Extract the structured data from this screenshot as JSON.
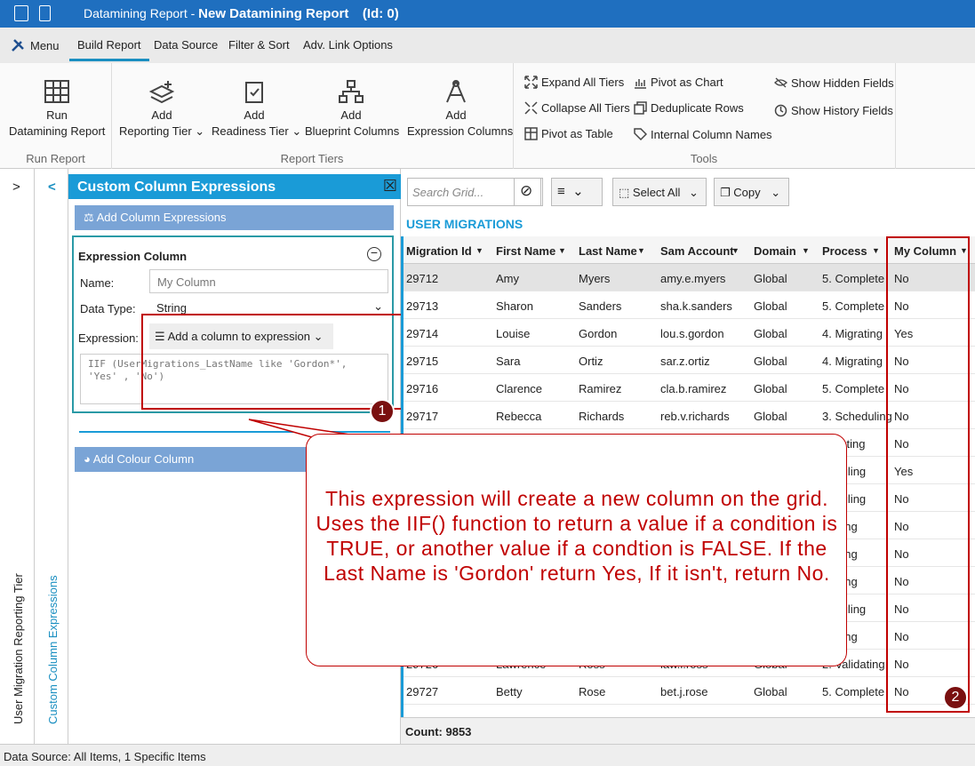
{
  "titlebar": {
    "app": "Datamining Report - ",
    "report": "New Datamining Report",
    "id": "(Id: 0)"
  },
  "menubar": {
    "menu": "Menu",
    "tabs": [
      "Build Report",
      "Data Source",
      "Filter & Sort",
      "Adv. Link Options"
    ]
  },
  "ribbon": {
    "run": {
      "line1": "Run",
      "line2": "Datamining Report"
    },
    "add_reporting": {
      "line1": "Add",
      "line2": "Reporting Tier"
    },
    "add_readiness": {
      "line1": "Add",
      "line2": "Readiness Tier"
    },
    "add_blueprint": {
      "line1": "Add",
      "line2": "Blueprint Columns"
    },
    "add_expression": {
      "line1": "Add",
      "line2": "Expression Columns"
    },
    "groups": {
      "run": "Run Report",
      "tiers": "Report Tiers",
      "tools": "Tools"
    },
    "tools": {
      "expand": "Expand All Tiers",
      "collapse": "Collapse All Tiers",
      "pivot_table": "Pivot as Table",
      "pivot_chart": "Pivot as Chart",
      "dedup": "Deduplicate Rows",
      "internal": "Internal Column Names",
      "hidden": "Show Hidden Fields",
      "history": "Show History Fields"
    }
  },
  "sidebar": {
    "tier_label": "User Migration Reporting Tier",
    "expr_label": "Custom Column Expressions",
    "expand": ">",
    "collapse": "<"
  },
  "panel": {
    "title": "Custom Column Expressions",
    "close": "☒",
    "add_expr": "Add Column Expressions",
    "section_title": "Expression Column",
    "name_label": "Name:",
    "name_placeholder": "My Column",
    "type_label": "Data Type:",
    "type_value": "String",
    "expr_label": "Expression:",
    "add_col_btn": "Add a column to expression",
    "expr_text": "IIF (UserMigrations_LastName like 'Gordon*', 'Yes' , 'No')",
    "add_colour": "Add Colour Column"
  },
  "grid": {
    "search_placeholder": "Search Grid...",
    "select_all": "Select All",
    "copy": "Copy",
    "title": "USER MIGRATIONS",
    "columns": [
      "Migration Id",
      "First Name",
      "Last Name",
      "Sam Account",
      "Domain",
      "Process",
      "My Column"
    ],
    "rows": [
      [
        "29712",
        "Amy",
        "Myers",
        "amy.e.myers",
        "Global",
        "5. Complete",
        "No"
      ],
      [
        "29713",
        "Sharon",
        "Sanders",
        "sha.k.sanders",
        "Global",
        "5. Complete",
        "No"
      ],
      [
        "29714",
        "Louise",
        "Gordon",
        "lou.s.gordon",
        "Global",
        "4. Migrating",
        "Yes"
      ],
      [
        "29715",
        "Sara",
        "Ortiz",
        "sar.z.ortiz",
        "Global",
        "4. Migrating",
        "No"
      ],
      [
        "29716",
        "Clarence",
        "Ramirez",
        "cla.b.ramirez",
        "Global",
        "5. Complete",
        "No"
      ],
      [
        "29717",
        "Rebecca",
        "Richards",
        "reb.v.richards",
        "Global",
        "3. Scheduling",
        "No"
      ],
      [
        "",
        "",
        "",
        "",
        "",
        "alidating",
        "No"
      ],
      [
        "",
        "",
        "",
        "",
        "",
        "heduling",
        "Yes"
      ],
      [
        "",
        "",
        "",
        "",
        "",
        "heduling",
        "No"
      ],
      [
        "",
        "",
        "",
        "",
        "",
        "grating",
        "No"
      ],
      [
        "",
        "",
        "",
        "",
        "",
        "grating",
        "No"
      ],
      [
        "",
        "",
        "",
        "",
        "",
        "grating",
        "No"
      ],
      [
        "",
        "",
        "",
        "",
        "",
        "heduling",
        "No"
      ],
      [
        "",
        "",
        "",
        "",
        "",
        "grating",
        "No"
      ],
      [
        "29726",
        "Lawrence",
        "Ross",
        "law.l.ross",
        "Global",
        "2. Validating",
        "No"
      ],
      [
        "29727",
        "Betty",
        "Rose",
        "bet.j.rose",
        "Global",
        "5. Complete",
        "No"
      ]
    ],
    "count": "Count: 9853"
  },
  "callout": {
    "text": "This expression will create a new column on the grid. Uses the IIF() function to return a value if a condition is TRUE, or another value if a condtion is FALSE. If the Last Name is 'Gordon' return Yes, If it isn't, return No."
  },
  "badges": {
    "one": "1",
    "two": "2"
  },
  "status": {
    "text": "Data Source:  All Items, 1 Specific Items"
  }
}
